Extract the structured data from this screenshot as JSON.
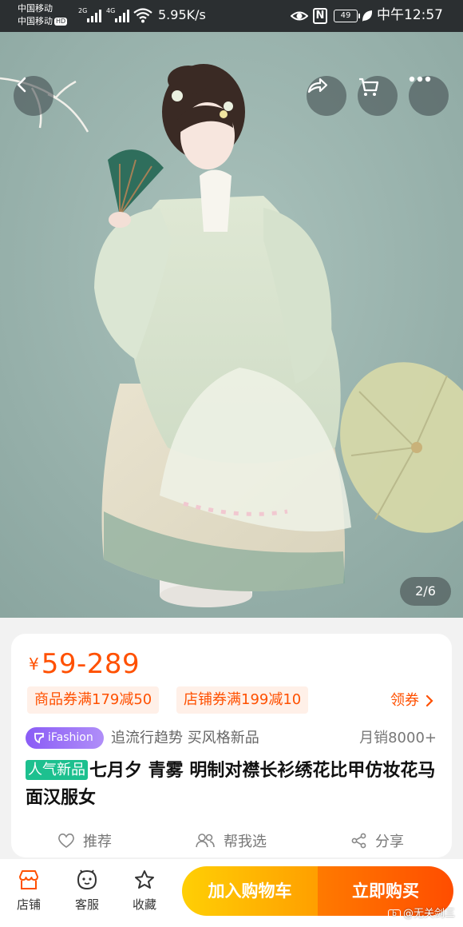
{
  "status_bar": {
    "carrier_1": "中国移动",
    "carrier_2": "中国移动",
    "hd_badge": "HD",
    "network_1": "2G",
    "network_2": "4G",
    "speed": "5.95K/s",
    "nfc": "N",
    "battery": "49",
    "time": "中午12:57"
  },
  "gallery": {
    "counter": "2/6",
    "icons": [
      "back-icon",
      "share-icon",
      "cart-icon",
      "more-icon"
    ]
  },
  "product": {
    "currency": "¥",
    "price": "59-289",
    "coupons": [
      "商品券满179减50",
      "店铺券满199减10"
    ],
    "claim_label": "领券",
    "brand_badge": "iFashion",
    "tagline": "追流行趋势 买风格新品",
    "monthly_sales": "月销8000+",
    "title_tag": "人气新品",
    "title": "七月夕 青雾 明制对襟长衫绣花比甲仿妆花马面汉服女",
    "actions": [
      "推荐",
      "帮我选",
      "分享"
    ]
  },
  "bottom_bar": {
    "tabs": [
      "店铺",
      "客服",
      "收藏"
    ],
    "add_to_cart": "加入购物车",
    "buy_now": "立即购买",
    "watermark": "@无关剑三"
  },
  "colors": {
    "accent": "#ff5000",
    "coupon_bg": "#fff0e8",
    "hot_tag": "#1dc08f",
    "cart_gradient": [
      "#ffcf05",
      "#ff9f00"
    ],
    "buy_gradient": [
      "#ff7a00",
      "#ff4d00"
    ],
    "ifashion_gradient": [
      "#8a5cf6",
      "#b08ef8"
    ],
    "photo_bg": "#9db6b0"
  }
}
